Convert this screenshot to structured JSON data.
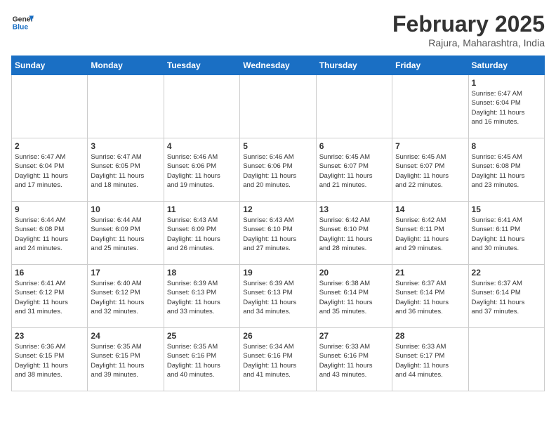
{
  "logo": {
    "line1": "General",
    "line2": "Blue"
  },
  "title": "February 2025",
  "subtitle": "Rajura, Maharashtra, India",
  "days_of_week": [
    "Sunday",
    "Monday",
    "Tuesday",
    "Wednesday",
    "Thursday",
    "Friday",
    "Saturday"
  ],
  "weeks": [
    [
      {
        "day": "",
        "info": ""
      },
      {
        "day": "",
        "info": ""
      },
      {
        "day": "",
        "info": ""
      },
      {
        "day": "",
        "info": ""
      },
      {
        "day": "",
        "info": ""
      },
      {
        "day": "",
        "info": ""
      },
      {
        "day": "1",
        "info": "Sunrise: 6:47 AM\nSunset: 6:04 PM\nDaylight: 11 hours\nand 16 minutes."
      }
    ],
    [
      {
        "day": "2",
        "info": "Sunrise: 6:47 AM\nSunset: 6:04 PM\nDaylight: 11 hours\nand 17 minutes."
      },
      {
        "day": "3",
        "info": "Sunrise: 6:47 AM\nSunset: 6:05 PM\nDaylight: 11 hours\nand 18 minutes."
      },
      {
        "day": "4",
        "info": "Sunrise: 6:46 AM\nSunset: 6:06 PM\nDaylight: 11 hours\nand 19 minutes."
      },
      {
        "day": "5",
        "info": "Sunrise: 6:46 AM\nSunset: 6:06 PM\nDaylight: 11 hours\nand 20 minutes."
      },
      {
        "day": "6",
        "info": "Sunrise: 6:45 AM\nSunset: 6:07 PM\nDaylight: 11 hours\nand 21 minutes."
      },
      {
        "day": "7",
        "info": "Sunrise: 6:45 AM\nSunset: 6:07 PM\nDaylight: 11 hours\nand 22 minutes."
      },
      {
        "day": "8",
        "info": "Sunrise: 6:45 AM\nSunset: 6:08 PM\nDaylight: 11 hours\nand 23 minutes."
      }
    ],
    [
      {
        "day": "9",
        "info": "Sunrise: 6:44 AM\nSunset: 6:08 PM\nDaylight: 11 hours\nand 24 minutes."
      },
      {
        "day": "10",
        "info": "Sunrise: 6:44 AM\nSunset: 6:09 PM\nDaylight: 11 hours\nand 25 minutes."
      },
      {
        "day": "11",
        "info": "Sunrise: 6:43 AM\nSunset: 6:09 PM\nDaylight: 11 hours\nand 26 minutes."
      },
      {
        "day": "12",
        "info": "Sunrise: 6:43 AM\nSunset: 6:10 PM\nDaylight: 11 hours\nand 27 minutes."
      },
      {
        "day": "13",
        "info": "Sunrise: 6:42 AM\nSunset: 6:10 PM\nDaylight: 11 hours\nand 28 minutes."
      },
      {
        "day": "14",
        "info": "Sunrise: 6:42 AM\nSunset: 6:11 PM\nDaylight: 11 hours\nand 29 minutes."
      },
      {
        "day": "15",
        "info": "Sunrise: 6:41 AM\nSunset: 6:11 PM\nDaylight: 11 hours\nand 30 minutes."
      }
    ],
    [
      {
        "day": "16",
        "info": "Sunrise: 6:41 AM\nSunset: 6:12 PM\nDaylight: 11 hours\nand 31 minutes."
      },
      {
        "day": "17",
        "info": "Sunrise: 6:40 AM\nSunset: 6:12 PM\nDaylight: 11 hours\nand 32 minutes."
      },
      {
        "day": "18",
        "info": "Sunrise: 6:39 AM\nSunset: 6:13 PM\nDaylight: 11 hours\nand 33 minutes."
      },
      {
        "day": "19",
        "info": "Sunrise: 6:39 AM\nSunset: 6:13 PM\nDaylight: 11 hours\nand 34 minutes."
      },
      {
        "day": "20",
        "info": "Sunrise: 6:38 AM\nSunset: 6:14 PM\nDaylight: 11 hours\nand 35 minutes."
      },
      {
        "day": "21",
        "info": "Sunrise: 6:37 AM\nSunset: 6:14 PM\nDaylight: 11 hours\nand 36 minutes."
      },
      {
        "day": "22",
        "info": "Sunrise: 6:37 AM\nSunset: 6:14 PM\nDaylight: 11 hours\nand 37 minutes."
      }
    ],
    [
      {
        "day": "23",
        "info": "Sunrise: 6:36 AM\nSunset: 6:15 PM\nDaylight: 11 hours\nand 38 minutes."
      },
      {
        "day": "24",
        "info": "Sunrise: 6:35 AM\nSunset: 6:15 PM\nDaylight: 11 hours\nand 39 minutes."
      },
      {
        "day": "25",
        "info": "Sunrise: 6:35 AM\nSunset: 6:16 PM\nDaylight: 11 hours\nand 40 minutes."
      },
      {
        "day": "26",
        "info": "Sunrise: 6:34 AM\nSunset: 6:16 PM\nDaylight: 11 hours\nand 41 minutes."
      },
      {
        "day": "27",
        "info": "Sunrise: 6:33 AM\nSunset: 6:16 PM\nDaylight: 11 hours\nand 43 minutes."
      },
      {
        "day": "28",
        "info": "Sunrise: 6:33 AM\nSunset: 6:17 PM\nDaylight: 11 hours\nand 44 minutes."
      },
      {
        "day": "",
        "info": ""
      }
    ]
  ]
}
